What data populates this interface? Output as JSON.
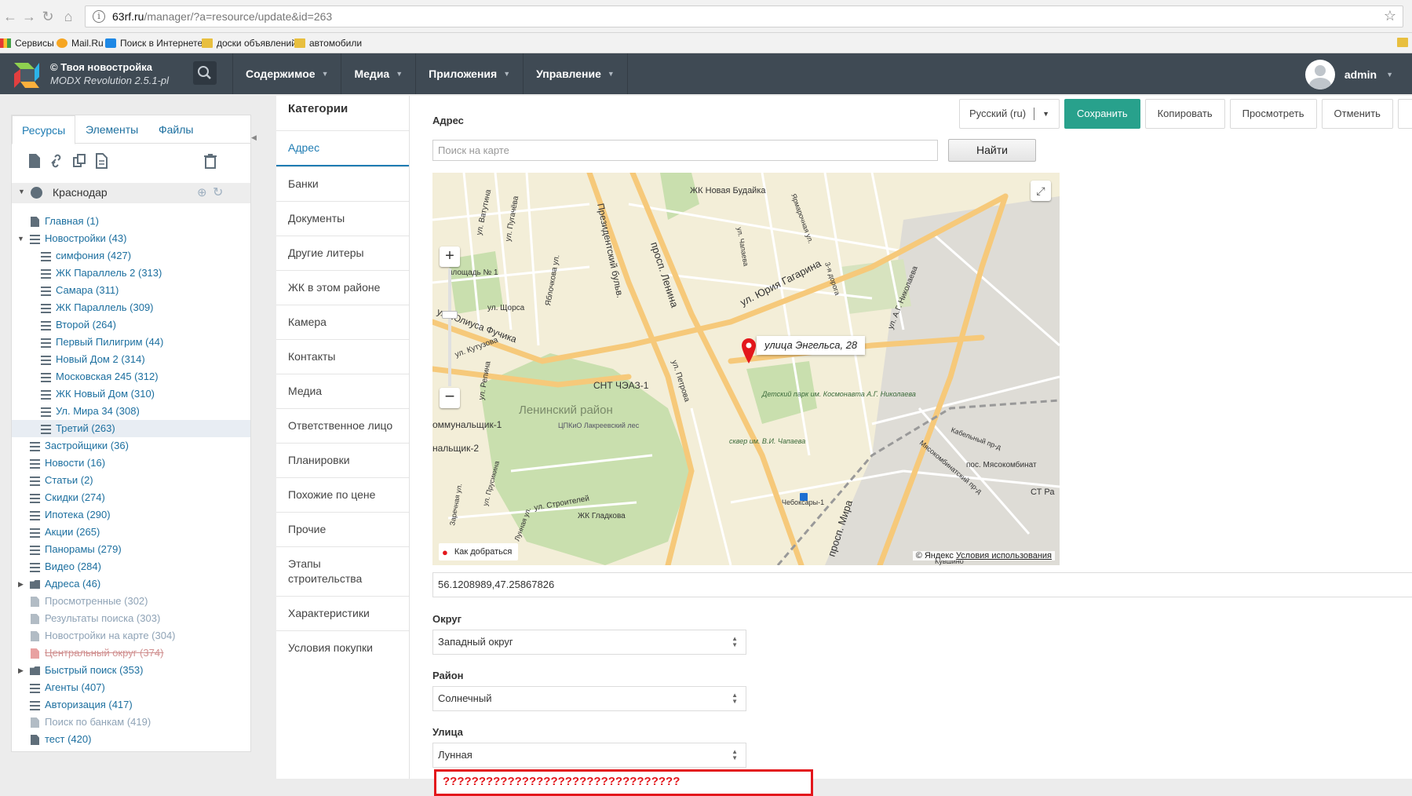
{
  "browser": {
    "url_host": "63rf.ru",
    "url_path": "/manager/?a=resource/update&id=263",
    "bookmarks": [
      "Сервисы",
      "Mail.Ru",
      "Поиск в Интернете",
      "доски объявлений",
      "автомобили"
    ]
  },
  "header": {
    "site_name": "© Твоя новостройка",
    "version": "MODX Revolution 2.5.1-pl",
    "nav": [
      "Содержимое",
      "Медиа",
      "Приложения",
      "Управление"
    ],
    "user": "admin"
  },
  "tree": {
    "tabs": [
      "Ресурсы",
      "Элементы",
      "Файлы"
    ],
    "root": "Краснодар",
    "nodes": [
      {
        "label": "Главная (1)"
      },
      {
        "label": "Новостройки (43)"
      },
      {
        "label": "симфония (427)"
      },
      {
        "label": "ЖК Параллель 2 (313)"
      },
      {
        "label": "Самара (311)"
      },
      {
        "label": "ЖК Параллель (309)"
      },
      {
        "label": "Второй (264)"
      },
      {
        "label": "Первый Пилигрим (44)"
      },
      {
        "label": "Новый Дом 2 (314)"
      },
      {
        "label": "Московская 245 (312)"
      },
      {
        "label": "ЖК Новый Дом (310)"
      },
      {
        "label": "Ул. Мира 34 (308)"
      },
      {
        "label": "Третий (263)"
      },
      {
        "label": "Застройщики (36)"
      },
      {
        "label": "Новости (16)"
      },
      {
        "label": "Статьи (2)"
      },
      {
        "label": "Скидки (274)"
      },
      {
        "label": "Ипотека (290)"
      },
      {
        "label": "Акции (265)"
      },
      {
        "label": "Панорамы (279)"
      },
      {
        "label": "Видео (284)"
      },
      {
        "label": "Адреса (46)"
      },
      {
        "label": "Просмотренные (302)"
      },
      {
        "label": "Результаты поиска (303)"
      },
      {
        "label": "Новостройки на карте (304)"
      },
      {
        "label": "Центральный округ (374)"
      },
      {
        "label": "Быстрый поиск (353)"
      },
      {
        "label": "Агенты (407)"
      },
      {
        "label": "Авторизация (417)"
      },
      {
        "label": "Поиск по банкам (419)"
      },
      {
        "label": "тест (420)"
      }
    ]
  },
  "categories": {
    "title": "Категории",
    "items": [
      "Адрес",
      "Банки",
      "Документы",
      "Другие литеры",
      "ЖК в этом районе",
      "Камера",
      "Контакты",
      "Медиа",
      "Ответственное лицо",
      "Планировки",
      "Похожие по цене",
      "Прочие",
      "Этапы строительства",
      "Характеристики",
      "Условия покупки"
    ]
  },
  "actions": {
    "language": "Русский (ru)",
    "save": "Сохранить",
    "copy": "Копировать",
    "view": "Просмотреть",
    "cancel": "Отменить"
  },
  "form": {
    "address_label": "Адрес",
    "map_search_placeholder": "Поиск на карте",
    "find_button": "Найти",
    "coords": "56.1208989,47.25867826",
    "okrug_label": "Округ",
    "okrug_value": "Западный округ",
    "rayon_label": "Район",
    "rayon_value": "Солнечный",
    "street_label": "Улица",
    "street_value": "Лунная",
    "warning": "?????????????????????????????????"
  },
  "map": {
    "balloon": "улица Энгельса, 28",
    "route_link": "Как добраться",
    "copyright": "© Яндекс",
    "terms": "Условия использования",
    "labels": [
      {
        "id": "jk-novaya",
        "text": "ЖК Новая Будайка"
      },
      {
        "id": "vatutina",
        "text": "ул. Ватутина"
      },
      {
        "id": "pugacheva",
        "text": "ул. Пугачёва"
      },
      {
        "id": "prezident",
        "text": "Президентский бульв."
      },
      {
        "id": "lenina",
        "text": "просп. Ленина"
      },
      {
        "id": "gagarina",
        "text": "ул. Юрия Гагарина"
      },
      {
        "id": "yarmarochnaya",
        "text": "Ярмарочная ул."
      },
      {
        "id": "chapaeva",
        "text": "ул. Чапаева"
      },
      {
        "id": "3-ya-doroga",
        "text": "3-я дорога"
      },
      {
        "id": "a-g-nikolaeva",
        "text": "ул. А.Г. Николаева"
      },
      {
        "id": "fuchika",
        "text": "ул. Юлиуса Фучика"
      },
      {
        "id": "shorsa",
        "text": "ул. Щорса"
      },
      {
        "id": "yablochkova",
        "text": "Яблочкова ул."
      },
      {
        "id": "kutuzova",
        "text": "ул. Кутузова"
      },
      {
        "id": "repina",
        "text": "ул. Репина"
      },
      {
        "id": "petrova",
        "text": "ул. Петрова"
      },
      {
        "id": "ploshchad",
        "text": "площадь № 1"
      },
      {
        "id": "snt",
        "text": "СНТ ЧЭАЗ-1"
      },
      {
        "id": "leninsky",
        "text": "Ленинский район"
      },
      {
        "id": "cpkio",
        "text": "ЦПКиО Лакреевский лес"
      },
      {
        "id": "kommun1",
        "text": "оммунальщик-1"
      },
      {
        "id": "kommun2",
        "text": "нальщик-2"
      },
      {
        "id": "park",
        "text": "Детский парк им. Космонавта А.Г. Николаева"
      },
      {
        "id": "skver",
        "text": "сквер им. В.И. Чапаева"
      },
      {
        "id": "kabelny",
        "text": "Кабельный пр-д"
      },
      {
        "id": "myasokombinat",
        "text": "пос. Мясокомбинат"
      },
      {
        "id": "myasokomb-ul",
        "text": "Мясокомбинатский пр-д"
      },
      {
        "id": "st-ra",
        "text": "СТ Ра"
      },
      {
        "id": "cheboksary",
        "text": "Чебоксары-1"
      },
      {
        "id": "stroiteley",
        "text": "ул. Строителей"
      },
      {
        "id": "jk-gladkova",
        "text": "ЖК Гладкова"
      },
      {
        "id": "lunnaya",
        "text": "Лунная ул."
      },
      {
        "id": "prusikina",
        "text": "ул. Прусикина"
      },
      {
        "id": "mira",
        "text": "просп. Мира"
      },
      {
        "id": "zarechnaya",
        "text": "Заречная ул."
      },
      {
        "id": "kuznetsova",
        "text": "Кувшино"
      }
    ]
  }
}
